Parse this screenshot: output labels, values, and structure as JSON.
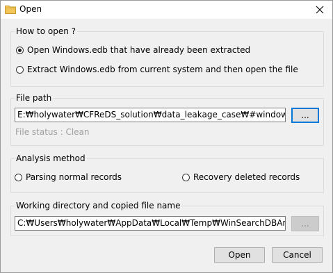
{
  "window": {
    "title": "Open"
  },
  "how_to_open": {
    "label": "How to open ?",
    "options": [
      {
        "label": "Open Windows.edb that have already been extracted",
        "selected": true
      },
      {
        "label": "Extract Windows.edb from current system and then open the file",
        "selected": false
      }
    ]
  },
  "file_path": {
    "label": "File path",
    "value": "E:₩holywater₩CFReDS_solution₩data_leakage_case₩#windows.e",
    "browse_label": "...",
    "status": "File status : Clean"
  },
  "analysis_method": {
    "label": "Analysis method",
    "options": [
      {
        "label": "Parsing normal records",
        "selected": false
      },
      {
        "label": "Recovery deleted records",
        "selected": false
      }
    ]
  },
  "working_dir": {
    "label": "Working directory and copied file name",
    "value": "C:₩Users₩holywater₩AppData₩Local₩Temp₩WinSearchDBAnaly",
    "browse_label": "..."
  },
  "footer": {
    "open_label": "Open",
    "cancel_label": "Cancel"
  },
  "colors": {
    "accent": "#0078d7",
    "folder": "#e8b848"
  }
}
